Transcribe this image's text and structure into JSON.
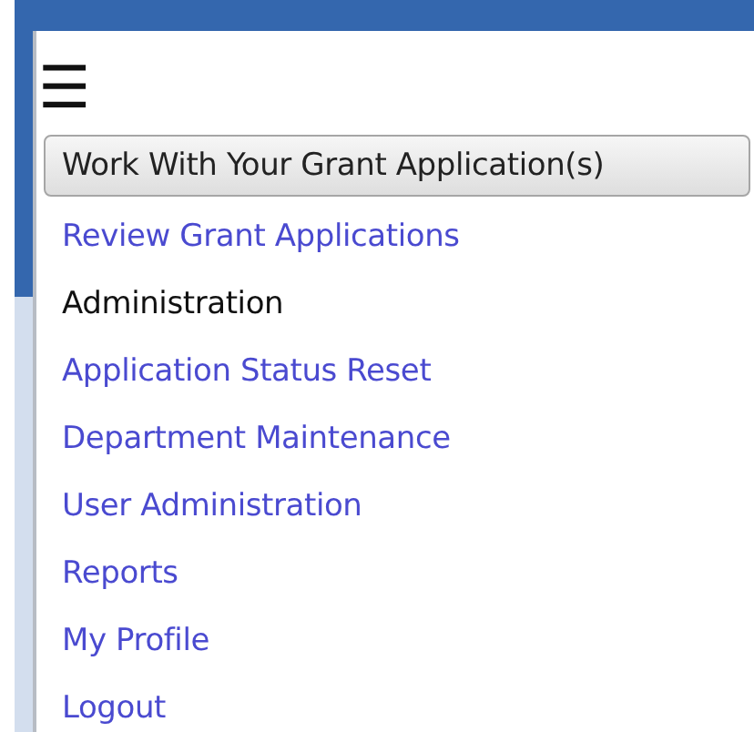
{
  "menu_button": {
    "label": "☰"
  },
  "items": [
    {
      "kind": "button",
      "label": "Work With Your Grant Application(s)"
    },
    {
      "kind": "link",
      "label": "Review Grant Applications"
    },
    {
      "kind": "heading",
      "label": "Administration"
    },
    {
      "kind": "link",
      "label": "Application Status Reset"
    },
    {
      "kind": "link",
      "label": "Department Maintenance"
    },
    {
      "kind": "link",
      "label": "User Administration"
    },
    {
      "kind": "link",
      "label": "Reports"
    },
    {
      "kind": "link",
      "label": "My Profile"
    },
    {
      "kind": "link",
      "label": "Logout"
    }
  ]
}
